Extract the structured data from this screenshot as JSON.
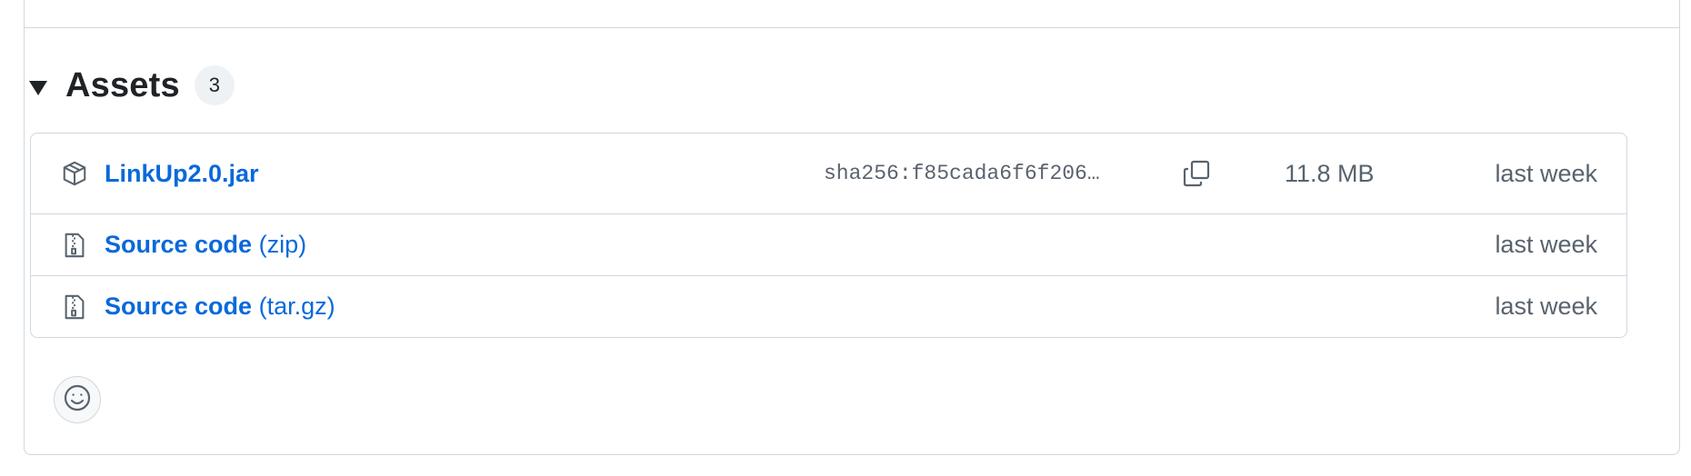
{
  "assets": {
    "title": "Assets",
    "count": "3",
    "caret_icon": "triangle-down-icon",
    "items": [
      {
        "name": "LinkUp2.0.jar",
        "icon": "package-icon",
        "sha": "sha256:f85cada6f6f206…",
        "copy_icon": "copy-icon",
        "size": "11.8 MB",
        "date": "last week"
      },
      {
        "name": "Source code",
        "ext": "(zip)",
        "icon": "file-zip-icon",
        "date": "last week"
      },
      {
        "name": "Source code",
        "ext": "(tar.gz)",
        "icon": "file-zip-icon",
        "date": "last week"
      }
    ]
  },
  "reactions": {
    "icon": "smiley-icon"
  },
  "colors": {
    "link": "#0969da",
    "muted": "#59636e",
    "border": "#d0d7de",
    "text": "#1f2328"
  }
}
